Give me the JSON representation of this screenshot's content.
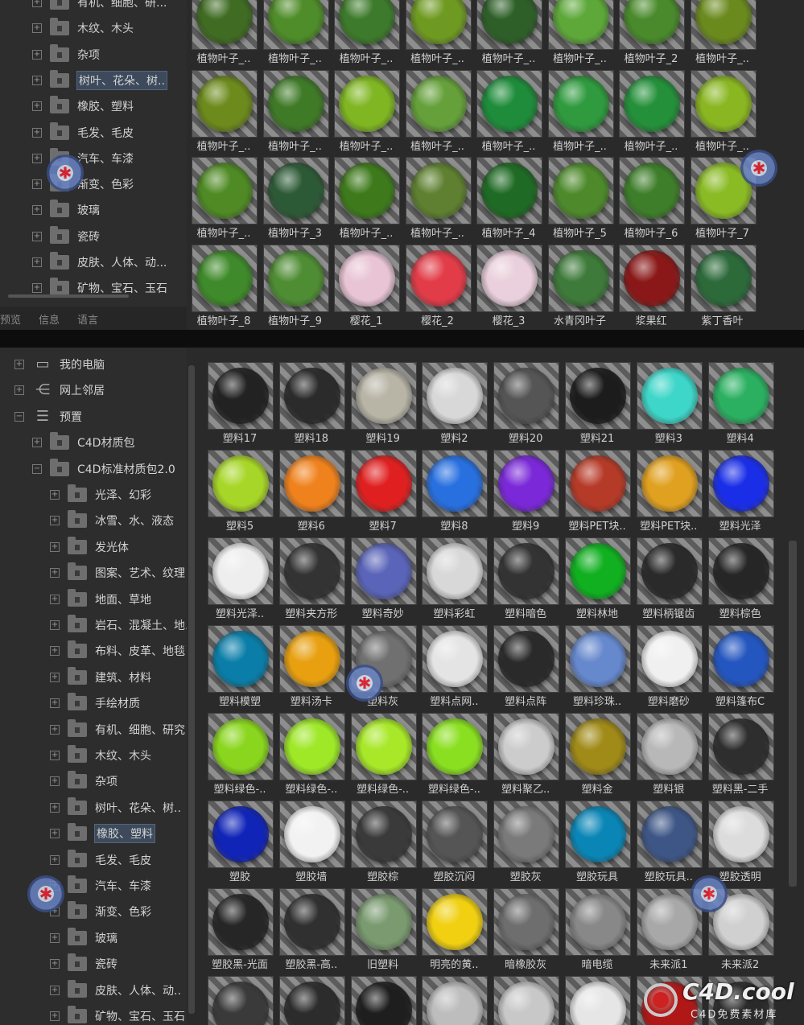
{
  "top_panel": {
    "tree": [
      {
        "label": "有机、细胞、研..."
      },
      {
        "label": "木纹、木头"
      },
      {
        "label": "杂项"
      },
      {
        "label": "树叶、花朵、树..",
        "selected": true
      },
      {
        "label": "橡胶、塑料"
      },
      {
        "label": "毛发、毛皮"
      },
      {
        "label": "汽车、车漆"
      },
      {
        "label": "渐变、色彩"
      },
      {
        "label": "玻璃"
      },
      {
        "label": "瓷砖"
      },
      {
        "label": "皮肤、人体、动..."
      },
      {
        "label": "矿物、宝石、玉石"
      }
    ],
    "tabs": [
      "预览",
      "信息",
      "语言"
    ],
    "materials": [
      {
        "name": "植物叶子_..",
        "color": "#3f6b22"
      },
      {
        "name": "植物叶子_..",
        "color": "#4f8c2a"
      },
      {
        "name": "植物叶子_..",
        "color": "#3d7a2b"
      },
      {
        "name": "植物叶子_..",
        "color": "#6f9a22"
      },
      {
        "name": "植物叶子_..",
        "color": "#2e5f28"
      },
      {
        "name": "植物叶子_..",
        "color": "#5ea83a"
      },
      {
        "name": "植物叶子_2",
        "color": "#4a8a2c"
      },
      {
        "name": "植物叶子_..",
        "color": "#6b8a1e"
      },
      {
        "name": "植物叶子_..",
        "color": "#6d8a1c"
      },
      {
        "name": "植物叶子_..",
        "color": "#3f7a27"
      },
      {
        "name": "植物叶子_..",
        "color": "#7fb622"
      },
      {
        "name": "植物叶子_..",
        "color": "#65a03a"
      },
      {
        "name": "植物叶子_..",
        "color": "#1e8c3a"
      },
      {
        "name": "植物叶子_..",
        "color": "#2f9a3e"
      },
      {
        "name": "植物叶子_..",
        "color": "#24903a"
      },
      {
        "name": "植物叶子_..",
        "color": "#8ab622"
      },
      {
        "name": "植物叶子_..",
        "color": "#4f8a24"
      },
      {
        "name": "植物叶子_3",
        "color": "#2d5a36"
      },
      {
        "name": "植物叶子_..",
        "color": "#3e7a1c"
      },
      {
        "name": "植物叶子_..",
        "color": "#5e8030"
      },
      {
        "name": "植物叶子_4",
        "color": "#1f6a24"
      },
      {
        "name": "植物叶子_5",
        "color": "#4e8a2c"
      },
      {
        "name": "植物叶子_6",
        "color": "#3e7e2a"
      },
      {
        "name": "植物叶子_7",
        "color": "#8abb25"
      },
      {
        "name": "植物叶子_8",
        "color": "#3f8a2a"
      },
      {
        "name": "植物叶子_9",
        "color": "#4f8d34"
      },
      {
        "name": "樱花_1",
        "color": "#e8c4d4"
      },
      {
        "name": "樱花_2",
        "color": "#e23c48"
      },
      {
        "name": "樱花_3",
        "color": "#ead0dc"
      },
      {
        "name": "水青冈叶子",
        "color": "#3e7a3a"
      },
      {
        "name": "浆果红",
        "color": "#8a1818"
      },
      {
        "name": "紫丁香叶",
        "color": "#2c6a3a"
      }
    ]
  },
  "bottom_panel": {
    "tree": [
      {
        "label": "我的电脑",
        "icon": "computer-icon",
        "level": 0
      },
      {
        "label": "网上邻居",
        "icon": "network-icon",
        "level": 0
      },
      {
        "label": "预置",
        "icon": "sliders-icon",
        "level": 0
      },
      {
        "label": "C4D材质包",
        "icon": "folder-icon",
        "level": 1
      },
      {
        "label": "C4D标准材质包2.0",
        "icon": "folder-open-icon",
        "level": 1
      },
      {
        "label": "光泽、幻彩",
        "icon": "folder-icon",
        "level": 2
      },
      {
        "label": "冰雪、水、液态",
        "icon": "folder-icon",
        "level": 2
      },
      {
        "label": "发光体",
        "icon": "folder-icon",
        "level": 2
      },
      {
        "label": "图案、艺术、纹理",
        "icon": "folder-icon",
        "level": 2
      },
      {
        "label": "地面、草地",
        "icon": "folder-icon",
        "level": 2
      },
      {
        "label": "岩石、混凝土、地..",
        "icon": "folder-icon",
        "level": 2
      },
      {
        "label": "布料、皮革、地毯",
        "icon": "folder-icon",
        "level": 2
      },
      {
        "label": "建筑、材料",
        "icon": "folder-icon",
        "level": 2
      },
      {
        "label": "手绘材质",
        "icon": "folder-icon",
        "level": 2
      },
      {
        "label": "有机、细胞、研究",
        "icon": "folder-icon",
        "level": 2
      },
      {
        "label": "木纹、木头",
        "icon": "folder-icon",
        "level": 2
      },
      {
        "label": "杂项",
        "icon": "folder-icon",
        "level": 2
      },
      {
        "label": "树叶、花朵、树..",
        "icon": "folder-icon",
        "level": 2
      },
      {
        "label": "橡胶、塑料",
        "icon": "folder-icon",
        "level": 2,
        "selected": true
      },
      {
        "label": "毛发、毛皮",
        "icon": "folder-icon",
        "level": 2
      },
      {
        "label": "汽车、车漆",
        "icon": "folder-icon",
        "level": 2
      },
      {
        "label": "渐变、色彩",
        "icon": "folder-icon",
        "level": 2
      },
      {
        "label": "玻璃",
        "icon": "folder-icon",
        "level": 2
      },
      {
        "label": "瓷砖",
        "icon": "folder-icon",
        "level": 2
      },
      {
        "label": "皮肤、人体、动..",
        "icon": "folder-icon",
        "level": 2
      },
      {
        "label": "矿物、宝石、玉石",
        "icon": "folder-icon",
        "level": 2
      }
    ],
    "materials": [
      {
        "name": "塑料17",
        "color": "#222222"
      },
      {
        "name": "塑料18",
        "color": "#2b2b2b"
      },
      {
        "name": "塑料19",
        "color": "#b8b4a6"
      },
      {
        "name": "塑料2",
        "color": "#d8d8d8"
      },
      {
        "name": "塑料20",
        "color": "#555555"
      },
      {
        "name": "塑料21",
        "color": "#1c1c1c"
      },
      {
        "name": "塑料3",
        "color": "#3ed6c8"
      },
      {
        "name": "塑料4",
        "color": "#2bb061"
      },
      {
        "name": "塑料5",
        "color": "#a8d628"
      },
      {
        "name": "塑料6",
        "color": "#f0821e"
      },
      {
        "name": "塑料7",
        "color": "#e02020"
      },
      {
        "name": "塑料8",
        "color": "#2870e0"
      },
      {
        "name": "塑料9",
        "color": "#7a28d8"
      },
      {
        "name": "塑料PET块..",
        "color": "#b63a28"
      },
      {
        "name": "塑料PET块..",
        "color": "#e0a020"
      },
      {
        "name": "塑料光泽",
        "color": "#1a2ee8"
      },
      {
        "name": "塑料光泽..",
        "color": "#eeeeee"
      },
      {
        "name": "塑料夹方形",
        "color": "#333333"
      },
      {
        "name": "塑料奇妙",
        "color": "#5a64b8"
      },
      {
        "name": "塑料彩虹",
        "color": "#d8d8d8"
      },
      {
        "name": "塑料暗色",
        "color": "#333333"
      },
      {
        "name": "塑料林地",
        "color": "#10b020"
      },
      {
        "name": "塑料柄锯齿",
        "color": "#2a2a2a"
      },
      {
        "name": "塑料棕色",
        "color": "#262626"
      },
      {
        "name": "塑料模塑",
        "color": "#0a7ea8"
      },
      {
        "name": "塑料汤卡",
        "color": "#e8a010"
      },
      {
        "name": "塑料灰",
        "color": "#707070"
      },
      {
        "name": "塑料点网..",
        "color": "#e4e4e4"
      },
      {
        "name": "塑料点阵",
        "color": "#2a2a2a"
      },
      {
        "name": "塑料珍珠..",
        "color": "#6688cc"
      },
      {
        "name": "塑料磨砂",
        "color": "#f0f0f0"
      },
      {
        "name": "塑料篷布C",
        "color": "#2456c0"
      },
      {
        "name": "塑料绿色-..",
        "color": "#8ad61e"
      },
      {
        "name": "塑料绿色-..",
        "color": "#9ee828"
      },
      {
        "name": "塑料绿色-..",
        "color": "#a8e828"
      },
      {
        "name": "塑料绿色-..",
        "color": "#8ae020"
      },
      {
        "name": "塑料聚乙..",
        "color": "#cccccc"
      },
      {
        "name": "塑料金",
        "color": "#a08a18"
      },
      {
        "name": "塑料银",
        "color": "#b8b8b8"
      },
      {
        "name": "塑料黑-二手",
        "color": "#2e2e2e"
      },
      {
        "name": "塑胶",
        "color": "#1024b8"
      },
      {
        "name": "塑胶墙",
        "color": "#f2f2f2"
      },
      {
        "name": "塑胶棕",
        "color": "#3a3a3a"
      },
      {
        "name": "塑胶沉闷",
        "color": "#555555"
      },
      {
        "name": "塑胶灰",
        "color": "#7a7a7a"
      },
      {
        "name": "塑胶玩具",
        "color": "#0a86b6"
      },
      {
        "name": "塑胶玩具..",
        "color": "#3e5686"
      },
      {
        "name": "塑胶透明",
        "color": "#dcdcdc"
      },
      {
        "name": "塑胶黑-光面",
        "color": "#262626"
      },
      {
        "name": "塑胶黑-高..",
        "color": "#303030"
      },
      {
        "name": "旧塑料",
        "color": "#7a9a70"
      },
      {
        "name": "明亮的黄..",
        "color": "#f0d010"
      },
      {
        "name": "暗橡胶灰",
        "color": "#6e6e6e"
      },
      {
        "name": "暗电缆",
        "color": "#888888"
      },
      {
        "name": "未来派1",
        "color": "#a8a8a8"
      },
      {
        "name": "未来派2",
        "color": "#d0d0d0"
      },
      {
        "name": "",
        "color": "#3a3a3a"
      },
      {
        "name": "",
        "color": "#2c2c2c"
      },
      {
        "name": "",
        "color": "#1e1e1e"
      },
      {
        "name": "",
        "color": "#bdbdbd"
      },
      {
        "name": "",
        "color": "#c8c8c8"
      },
      {
        "name": "",
        "color": "#e6e6e6"
      },
      {
        "name": "",
        "color": "#b01818"
      },
      {
        "name": "",
        "color": "#2a2a2a"
      }
    ]
  },
  "watermark": {
    "title": "C4D.cool",
    "subtitle": "C4D免费素材库"
  }
}
